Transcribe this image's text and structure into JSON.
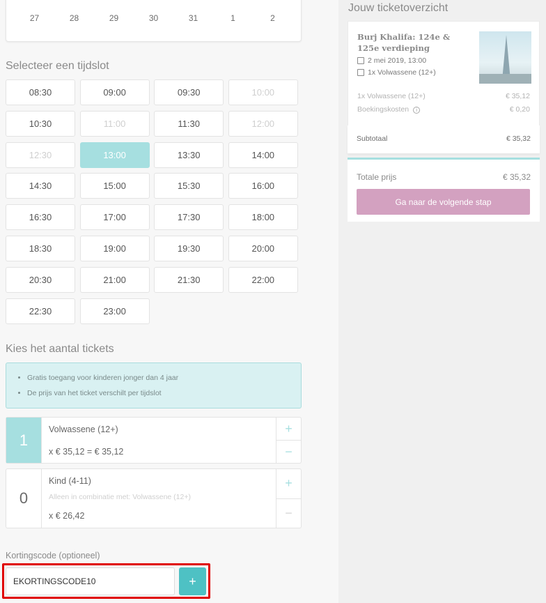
{
  "calendar": {
    "days": [
      "27",
      "28",
      "29",
      "30",
      "31",
      "1",
      "2"
    ]
  },
  "timeslot_title": "Selecteer een tijdslot",
  "timeslots": [
    {
      "label": "08:30",
      "state": "available"
    },
    {
      "label": "09:00",
      "state": "available"
    },
    {
      "label": "09:30",
      "state": "available"
    },
    {
      "label": "10:00",
      "state": "disabled"
    },
    {
      "label": "10:30",
      "state": "available"
    },
    {
      "label": "11:00",
      "state": "disabled"
    },
    {
      "label": "11:30",
      "state": "available"
    },
    {
      "label": "12:00",
      "state": "disabled"
    },
    {
      "label": "12:30",
      "state": "disabled"
    },
    {
      "label": "13:00",
      "state": "selected"
    },
    {
      "label": "13:30",
      "state": "available"
    },
    {
      "label": "14:00",
      "state": "available"
    },
    {
      "label": "14:30",
      "state": "available"
    },
    {
      "label": "15:00",
      "state": "available"
    },
    {
      "label": "15:30",
      "state": "available"
    },
    {
      "label": "16:00",
      "state": "available"
    },
    {
      "label": "16:30",
      "state": "available"
    },
    {
      "label": "17:00",
      "state": "available"
    },
    {
      "label": "17:30",
      "state": "available"
    },
    {
      "label": "18:00",
      "state": "available"
    },
    {
      "label": "18:30",
      "state": "available"
    },
    {
      "label": "19:00",
      "state": "available"
    },
    {
      "label": "19:30",
      "state": "available"
    },
    {
      "label": "20:00",
      "state": "available"
    },
    {
      "label": "20:30",
      "state": "available"
    },
    {
      "label": "21:00",
      "state": "available"
    },
    {
      "label": "21:30",
      "state": "available"
    },
    {
      "label": "22:00",
      "state": "available"
    },
    {
      "label": "22:30",
      "state": "available"
    },
    {
      "label": "23:00",
      "state": "available"
    }
  ],
  "tickets_title": "Kies het aantal tickets",
  "info": [
    "Gratis toegang voor kinderen jonger dan 4 jaar",
    "De prijs van het ticket verschilt per tijdslot"
  ],
  "tickets": [
    {
      "count": "1",
      "name": "Volwassene (12+)",
      "note": "",
      "price": "x € 35,12 = € 35,12",
      "plus": "+",
      "minus": "−"
    },
    {
      "count": "0",
      "name": "Kind (4-11)",
      "note": "Alleen in combinatie met: Volwassene (12+)",
      "price": "x € 26,42",
      "plus": "+",
      "minus": "−"
    }
  ],
  "discount": {
    "label": "Kortingscode (optioneel)",
    "value": "EKORTINGSCODE10",
    "add": "+"
  },
  "overview": {
    "title": "Jouw ticketoverzicht",
    "product": "Burj Khalifa: 124e & 125e verdieping",
    "date": "2 mei 2019, 13:00",
    "qty": "1x Volwassene (12+)",
    "lines": [
      {
        "label": "1x Volwassene (12+)",
        "amount": "€ 35,12"
      },
      {
        "label": "Boekingskosten",
        "amount": "€ 0,20",
        "info": "i"
      }
    ],
    "subtotal_label": "Subtotaal",
    "subtotal": "€ 35,32",
    "total_label": "Totale prijs",
    "total": "€ 35,32",
    "next": "Ga naar de volgende stap"
  },
  "colors": {
    "accent": "#a6dfe0",
    "button": "#4ec1c4",
    "cta": "#d3a1c0",
    "highlight": "#e00000"
  }
}
